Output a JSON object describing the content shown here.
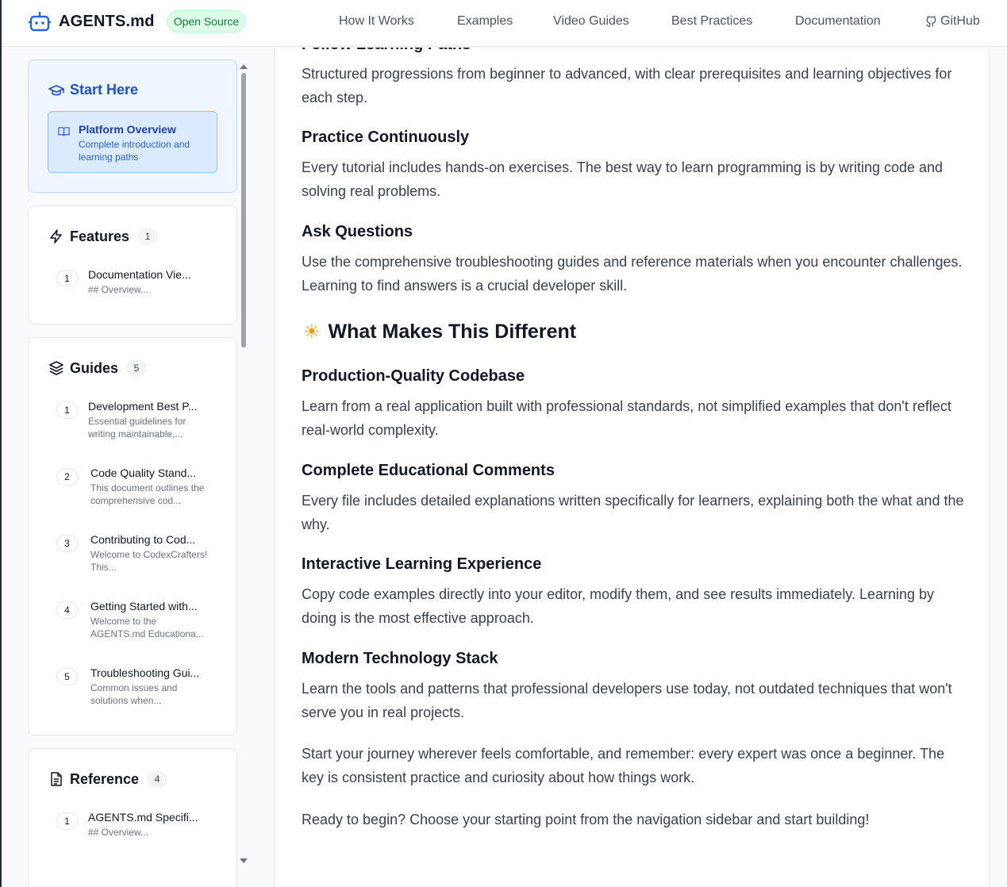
{
  "header": {
    "brand": "AGENTS.md",
    "badge": "Open Source",
    "nav": [
      "How It Works",
      "Examples",
      "Video Guides",
      "Best Practices",
      "Documentation",
      "GitHub"
    ]
  },
  "sidebar": {
    "start": {
      "title": "Start Here",
      "item": {
        "title": "Platform Overview",
        "desc": "Complete introduction and learning paths"
      }
    },
    "features": {
      "title": "Features",
      "count": "1",
      "items": [
        {
          "num": "1",
          "title": "Documentation Vie...",
          "desc": "## Overview..."
        }
      ]
    },
    "guides": {
      "title": "Guides",
      "count": "5",
      "items": [
        {
          "num": "1",
          "title": "Development Best P...",
          "desc": "Essential guidelines for writing maintainable,..."
        },
        {
          "num": "2",
          "title": "Code Quality Stand...",
          "desc": "This document outlines the comprehensive cod..."
        },
        {
          "num": "3",
          "title": "Contributing to Cod...",
          "desc": "Welcome to CodexCrafters! This..."
        },
        {
          "num": "4",
          "title": "Getting Started with...",
          "desc": "Welcome to the AGENTS.md Educationa..."
        },
        {
          "num": "5",
          "title": "Troubleshooting Gui...",
          "desc": "Common issues and solutions when..."
        }
      ]
    },
    "reference": {
      "title": "Reference",
      "count": "4",
      "items": [
        {
          "num": "1",
          "title": "AGENTS.md Specifi...",
          "desc": "## Overview..."
        }
      ]
    }
  },
  "content": {
    "partial_heading": "Follow Learning Paths",
    "s1_p": "Structured progressions from beginner to advanced, with clear prerequisites and learning objectives for each step.",
    "s2_h": "Practice Continuously",
    "s2_p": "Every tutorial includes hands-on exercises. The best way to learn programming is by writing code and solving real problems.",
    "s3_h": "Ask Questions",
    "s3_p": "Use the comprehensive troubleshooting guides and reference materials when you encounter challenges. Learning to find answers is a crucial developer skill.",
    "h2": "What Makes This Different",
    "s4_h": "Production-Quality Codebase",
    "s4_p": "Learn from a real application built with professional standards, not simplified examples that don't reflect real-world complexity.",
    "s5_h": "Complete Educational Comments",
    "s5_p": "Every file includes detailed explanations written specifically for learners, explaining both the what and the why.",
    "s6_h": "Interactive Learning Experience",
    "s6_p": "Copy code examples directly into your editor, modify them, and see results immediately. Learning by doing is the most effective approach.",
    "s7_h": "Modern Technology Stack",
    "s7_p": "Learn the tools and patterns that professional developers use today, not outdated techniques that won't serve you in real projects.",
    "p_final1": "Start your journey wherever feels comfortable, and remember: every expert was once a beginner. The key is consistent practice and curiosity about how things work.",
    "p_final2": "Ready to begin? Choose your starting point from the navigation sidebar and start building!"
  }
}
